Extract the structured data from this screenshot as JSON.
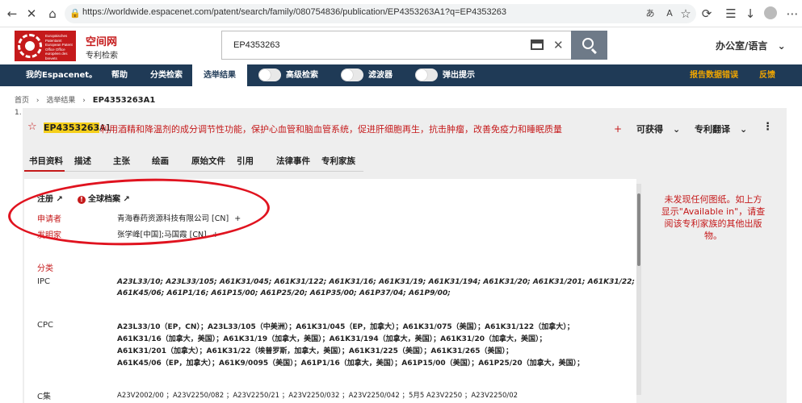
{
  "browser": {
    "url": "https://worldwide.espacenet.com/patent/search/family/080754836/publication/EP4353263A1?q=EP4353263"
  },
  "header": {
    "logo_text": "Europäisches Patentamt European Patent Office Office européen des brevets",
    "brand_title": "空间网",
    "brand_subtitle": "专利检索",
    "search_value": "EP4353263",
    "office_language": "办公室/语言"
  },
  "nav": {
    "my_espacenet": "我的Espacenet。",
    "help": "帮助",
    "classification_search": "分类检索",
    "results": "选举结果",
    "advanced_search": "高级检索",
    "filter": "滤波器",
    "popups": "弹出提示",
    "report_error": "报告数据错误",
    "feedback": "反馈"
  },
  "breadcrumb": {
    "home": "首页",
    "results": "选举结果",
    "current": "EP4353263A1"
  },
  "result": {
    "index": "1.",
    "number_highlight": "EP4353263",
    "number_suffix": "A1",
    "title": "利用酒精和降温剂的成分调节性功能，保护心血管和脑血管系统，促进肝细胞再生，抗击肿瘤，改善免疫力和睡眠质量",
    "available": "可获得",
    "translate": "专利翻译"
  },
  "tabs": [
    "书目资料",
    "描述",
    "主张",
    "绘画",
    "原始文件",
    "引用",
    "法律事件",
    "专利家族"
  ],
  "biblio": {
    "register": "注册",
    "global_dossier": "全球档案",
    "applicant_label": "申请者",
    "applicant_value": "青海春药资源科技有限公司 [CN]",
    "inventor_label": "发明家",
    "inventor_value": "张学峰[中国];马国霞 [CN]",
    "classification_label": "分类",
    "ipc_label": "IPC",
    "ipc_lines": [
      "A23L33/10; A23L33/105; A61K31/045; A61K31/122; A61K31/16; A61K31/19; A61K31/194; A61K31/20; A61K31/201; A61K31/22;",
      "A61K45/06; A61P1/16; A61P15/00; A61P25/20; A61P35/00; A61P37/04; A61P9/00;"
    ],
    "cpc_label": "CPC",
    "cpc_lines": [
      "A23L33/10（EP，CN）；A23L33/105（中美洲）；A61K31/045（EP，加拿大）；A61K31/075（美国）；A61K31/122（加拿大）；",
      "A61K31/16（加拿大，美国）；A61K31/19（加拿大，美国）；A61K31/194（加拿大，美国）；A61K31/20（加拿大，美国）；",
      "A61K31/201（加拿大）；A61K31/22（埃普罗斯，加拿大，美国）；A61K31/225（美国）；A61K31/265（美国）；",
      "A61K45/06（EP，加拿大）；A61K9/0095（美国）；A61P1/16（加拿大，美国）；A61P15/00（美国）；A61P25/20（加拿大，美国）；"
    ],
    "c_label": "C集",
    "c_line": "A23V2002/00 ；A23V2250/082 ；A23V2250/21 ；A23V2250/032 ；A23V2250/042 ；5月5 A23V2250 ；A23V2250/02"
  },
  "sidebar_note": "未发现任何图纸。如上方显示\"Available in\"，请查阅该专利家族的其他出版物。",
  "colors": {
    "brand_red": "#c51a1b",
    "nav_bg": "#1f3a56",
    "highlight": "#f5cf1a",
    "nav_accent": "#f0a500",
    "annotation_red": "#e0131f"
  }
}
